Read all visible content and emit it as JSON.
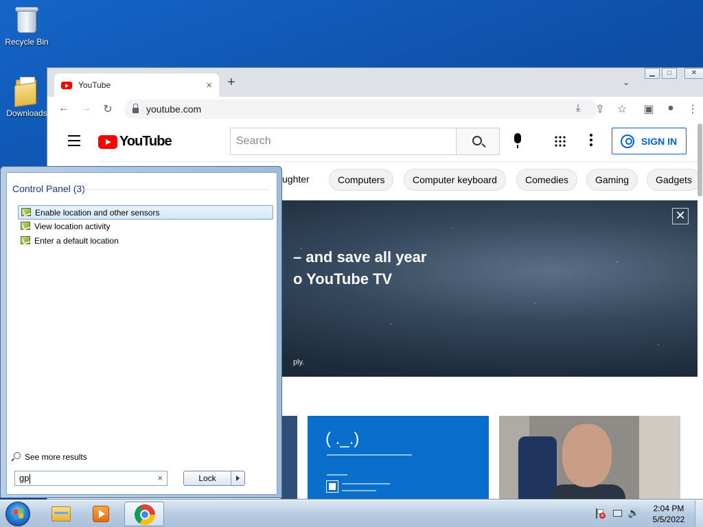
{
  "desktop": {
    "icons": [
      {
        "label": "Recycle Bin",
        "icon": "recycle-bin-icon"
      },
      {
        "label": "Downloads",
        "icon": "folder-icon"
      }
    ]
  },
  "browser": {
    "tab": {
      "title": "YouTube",
      "close": "×"
    },
    "new_tab": "+",
    "tab_search": "⌄",
    "window_controls": {
      "minimize": "▁",
      "maximize": "□",
      "close": "✕"
    },
    "nav": {
      "back": "←",
      "forward": "→",
      "reload": "↻"
    },
    "url": "youtube.com",
    "actions": {
      "install": "⤓",
      "share": "⇪",
      "bookmark": "☆",
      "sidepanel": "▣",
      "profile": "●",
      "menu": "⋮"
    }
  },
  "youtube": {
    "logo_text": "YouTube",
    "search": {
      "placeholder": "Search"
    },
    "sign_in": "SIGN IN",
    "chips": [
      "ughter",
      "Computers",
      "Computer keyboard",
      "Comedies",
      "Gaming",
      "Gadgets"
    ],
    "banner": {
      "line1": "– and save all year",
      "line2": "o YouTube TV",
      "fine_print": "ply.",
      "close": "✕"
    },
    "thumbnail_text": {
      "bsod_face": "( ._.)"
    }
  },
  "start_menu": {
    "heading": "Control Panel (3)",
    "results": [
      {
        "label": "Enable location and other sensors",
        "selected": true
      },
      {
        "label": "View location activity",
        "selected": false
      },
      {
        "label": "Enter a default location",
        "selected": false
      }
    ],
    "see_more": "See more results",
    "search_value": "gp",
    "clear": "×",
    "lock_button": "Lock"
  },
  "taskbar": {
    "pinned": [
      "windows-explorer",
      "windows-media-player",
      "google-chrome"
    ],
    "active": "google-chrome",
    "clock": {
      "time": "2:04 PM",
      "date": "5/5/2022"
    },
    "volume": "🔊"
  }
}
